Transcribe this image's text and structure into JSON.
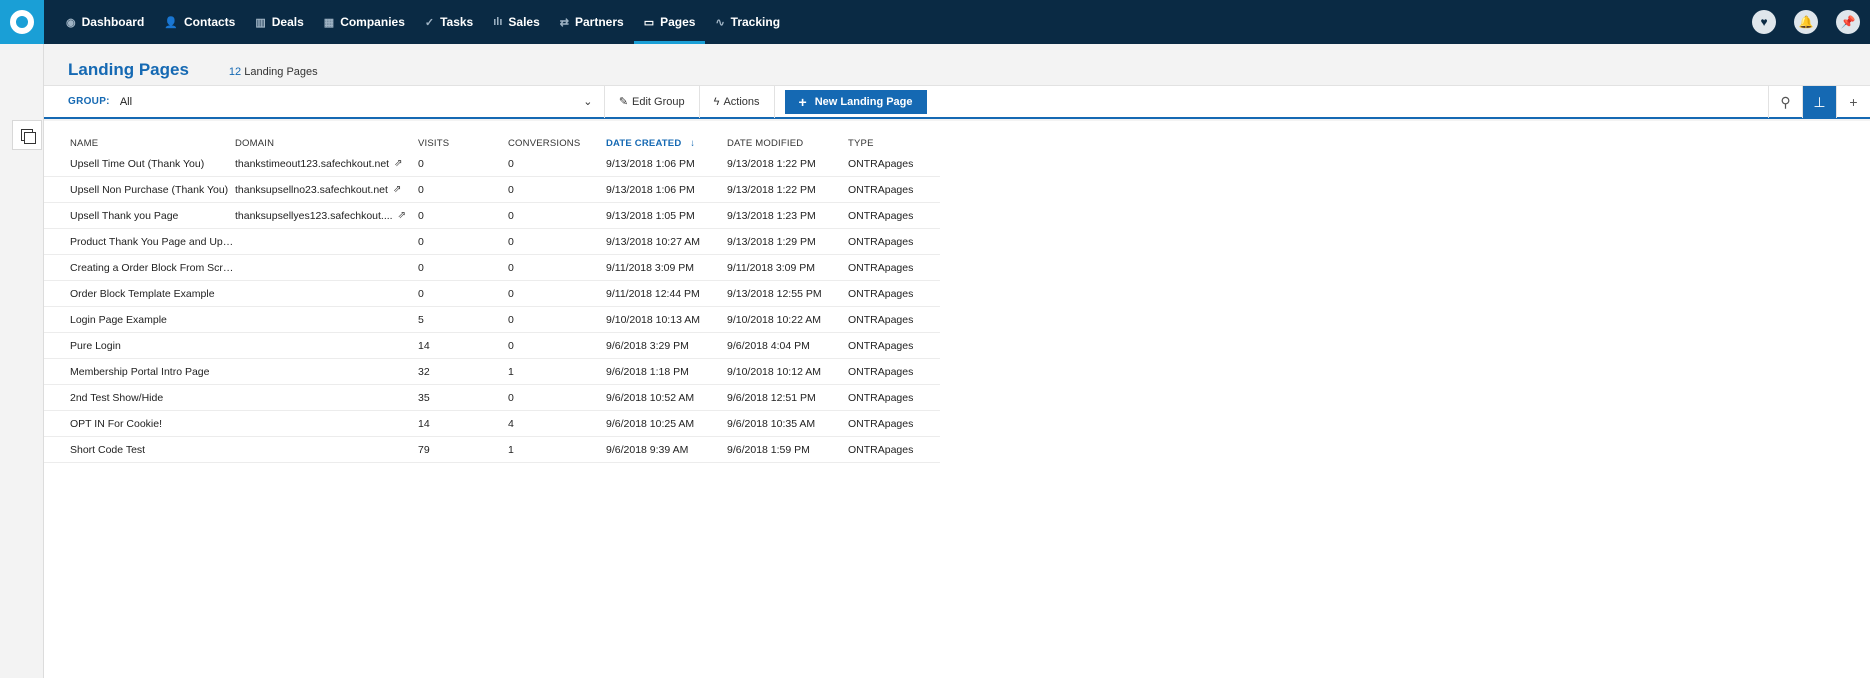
{
  "nav": {
    "items": [
      {
        "label": "Dashboard",
        "icon": "dashboard-icon",
        "glyph": "◉",
        "active": false
      },
      {
        "label": "Contacts",
        "icon": "contact-icon",
        "glyph": "👤",
        "active": false
      },
      {
        "label": "Deals",
        "icon": "deals-icon",
        "glyph": "▥",
        "active": false
      },
      {
        "label": "Companies",
        "icon": "companies-icon",
        "glyph": "▦",
        "active": false
      },
      {
        "label": "Tasks",
        "icon": "check-icon",
        "glyph": "✓",
        "active": false
      },
      {
        "label": "Sales",
        "icon": "bar-chart-icon",
        "glyph": "ılı",
        "active": false
      },
      {
        "label": "Partners",
        "icon": "handshake-icon",
        "glyph": "⇄",
        "active": false
      },
      {
        "label": "Pages",
        "icon": "page-icon",
        "glyph": "▭",
        "active": true
      },
      {
        "label": "Tracking",
        "icon": "tracking-icon",
        "glyph": "∿",
        "active": false
      }
    ],
    "right_icons": [
      {
        "name": "heart-icon",
        "glyph": "♥"
      },
      {
        "name": "bell-icon",
        "glyph": "🔔"
      },
      {
        "name": "pin-icon",
        "glyph": "📌"
      }
    ]
  },
  "header": {
    "title": "Landing Pages",
    "count_num": "12",
    "count_label": "Landing Pages"
  },
  "toolbar": {
    "group_label": "GROUP:",
    "group_value": "All",
    "edit_group": "Edit Group",
    "actions": "Actions",
    "new_button": "New Landing Page"
  },
  "table": {
    "columns": {
      "name": "NAME",
      "domain": "DOMAIN",
      "visits": "VISITS",
      "conversions": "CONVERSIONS",
      "date_created": "DATE CREATED",
      "date_modified": "DATE MODIFIED",
      "type": "TYPE"
    },
    "sort_indicator": "↓",
    "rows": [
      {
        "name": "Upsell Time Out (Thank You)",
        "domain": "thankstimeout123.safechkout.net",
        "visits": "0",
        "conversions": "0",
        "created": "9/13/2018 1:06 PM",
        "modified": "9/13/2018 1:22 PM",
        "type": "ONTRApages"
      },
      {
        "name": "Upsell Non Purchase (Thank You)",
        "domain": "thanksupsellno23.safechkout.net",
        "visits": "0",
        "conversions": "0",
        "created": "9/13/2018 1:06 PM",
        "modified": "9/13/2018 1:22 PM",
        "type": "ONTRApages"
      },
      {
        "name": "Upsell Thank you Page",
        "domain": "thanksupsellyes123.safechkout....",
        "visits": "0",
        "conversions": "0",
        "created": "9/13/2018 1:05 PM",
        "modified": "9/13/2018 1:23 PM",
        "type": "ONTRApages"
      },
      {
        "name": "Product Thank You Page and Ups...",
        "domain": "",
        "visits": "0",
        "conversions": "0",
        "created": "9/13/2018 10:27 AM",
        "modified": "9/13/2018 1:29 PM",
        "type": "ONTRApages"
      },
      {
        "name": "Creating a Order Block From Scrat...",
        "domain": "",
        "visits": "0",
        "conversions": "0",
        "created": "9/11/2018 3:09 PM",
        "modified": "9/11/2018 3:09 PM",
        "type": "ONTRApages"
      },
      {
        "name": "Order Block Template Example",
        "domain": "",
        "visits": "0",
        "conversions": "0",
        "created": "9/11/2018 12:44 PM",
        "modified": "9/13/2018 12:55 PM",
        "type": "ONTRApages"
      },
      {
        "name": "Login Page Example",
        "domain": "",
        "visits": "5",
        "conversions": "0",
        "created": "9/10/2018 10:13 AM",
        "modified": "9/10/2018 10:22 AM",
        "type": "ONTRApages"
      },
      {
        "name": "Pure Login",
        "domain": "",
        "visits": "14",
        "conversions": "0",
        "created": "9/6/2018 3:29 PM",
        "modified": "9/6/2018 4:04 PM",
        "type": "ONTRApages"
      },
      {
        "name": "Membership Portal Intro Page",
        "domain": "",
        "visits": "32",
        "conversions": "1",
        "created": "9/6/2018 1:18 PM",
        "modified": "9/10/2018 10:12 AM",
        "type": "ONTRApages"
      },
      {
        "name": "2nd Test Show/Hide",
        "domain": "",
        "visits": "35",
        "conversions": "0",
        "created": "9/6/2018 10:52 AM",
        "modified": "9/6/2018 12:51 PM",
        "type": "ONTRApages"
      },
      {
        "name": "OPT IN For Cookie!",
        "domain": "",
        "visits": "14",
        "conversions": "4",
        "created": "9/6/2018 10:25 AM",
        "modified": "9/6/2018 10:35 AM",
        "type": "ONTRApages"
      },
      {
        "name": "Short Code Test",
        "domain": "",
        "visits": "79",
        "conversions": "1",
        "created": "9/6/2018 9:39 AM",
        "modified": "9/6/2018 1:59 PM",
        "type": "ONTRApages"
      }
    ]
  },
  "colors": {
    "nav_bg": "#0a2a44",
    "accent": "#1569b3",
    "logo_bg": "#1a9fd6"
  }
}
